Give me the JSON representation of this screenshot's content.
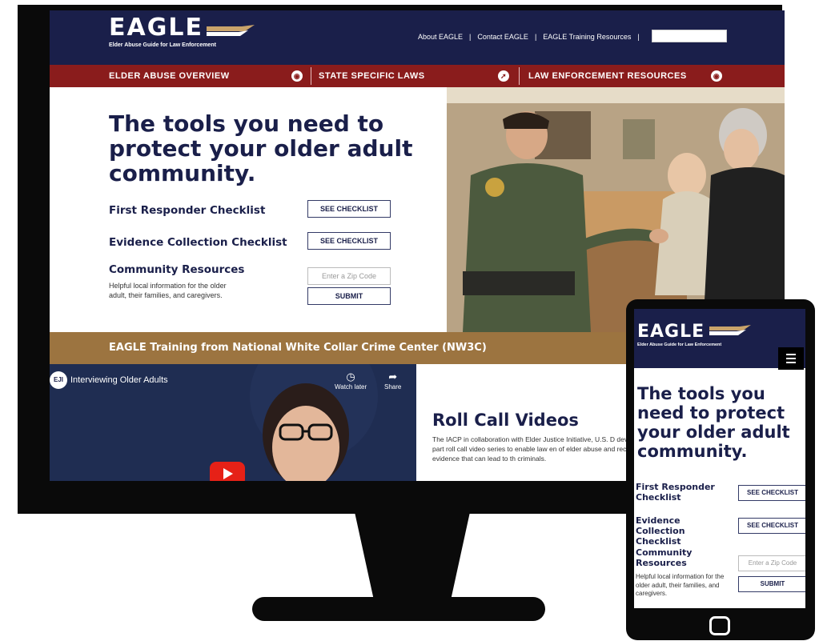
{
  "desktop": {
    "logo": {
      "word": "EAGLE",
      "tagline": "Elder Abuse Guide for Law Enforcement"
    },
    "top_links": [
      "About EAGLE",
      "Contact EAGLE",
      "EAGLE Training Resources"
    ],
    "top_separator": "|",
    "nav": [
      {
        "label": "ELDER ABUSE OVERVIEW",
        "icon": "chevron-down-circle-icon",
        "glyph": "◉"
      },
      {
        "label": "STATE SPECIFIC LAWS",
        "icon": "arrow-circle-icon",
        "glyph": "➚"
      },
      {
        "label": "LAW ENFORCEMENT RESOURCES",
        "icon": "chevron-down-circle-icon",
        "glyph": "◉"
      }
    ],
    "hero": {
      "title": "The tools you need to protect your older adult community.",
      "first_responder_label": "First Responder Checklist",
      "evidence_label": "Evidence Collection Checklist",
      "checklist_button": "SEE CHECKLIST",
      "community_label": "Community Resources",
      "community_desc": "Helpful local information for the older adult, their families, and caregivers.",
      "zip_placeholder": "Enter a Zip Code",
      "submit_button": "SUBMIT"
    },
    "training_bar": "EAGLE Training from National White Collar Crime Center (NW3C)",
    "video": {
      "badge": "EJI",
      "title": "Interviewing Older Adults",
      "watch_later": "Watch later",
      "share": "Share"
    },
    "roll_call": {
      "title": "Roll Call Videos",
      "text": "The IACP in collaboration with Elder Justice Initiative, U.S. D developed a six-part roll call video series to enable law en of elder abuse and recognize evidence that can lead to th criminals."
    }
  },
  "mobile": {
    "logo": {
      "word": "EAGLE",
      "tagline": "Elder Abuse Guide for Law Enforcement"
    },
    "title": "The tools you need to protect your older adult community.",
    "first_responder_label": "First Responder Checklist",
    "evidence_label": "Evidence Collection Checklist",
    "checklist_button": "SEE CHECKLIST",
    "community_label": "Community Resources",
    "community_desc": "Helpful local information for the older adult, their families, and caregivers.",
    "zip_placeholder": "Enter a Zip Code",
    "submit_button": "SUBMIT"
  },
  "colors": {
    "navy": "#1a1f4a",
    "maroon": "#8a1c1c",
    "gold": "#9c7440",
    "youtube_red": "#e62117"
  }
}
